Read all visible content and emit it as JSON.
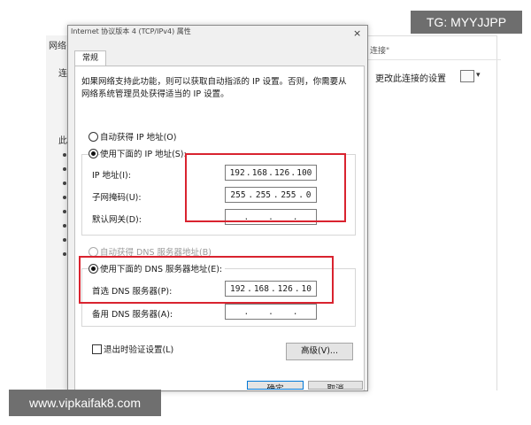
{
  "background_window": {
    "left_title": "网络",
    "left_strip_chars": [
      "连",
      "此"
    ],
    "address_text": "连接\"",
    "change_settings_label": "更改此连接的设置",
    "view_icon": "view-options-icon",
    "view_arrow": "▾"
  },
  "dialog": {
    "title": "Internet 协议版本 4 (TCP/IPv4) 属性",
    "close_glyph": "×",
    "tab_general": "常规",
    "description": "如果网络支持此功能，则可以获取自动指派的 IP 设置。否则，你需要从网络系统管理员处获得适当的 IP 设置。",
    "auto_ip_label": "自动获得 IP 地址(O)",
    "use_ip_label": "使用下面的 IP 地址(S):",
    "ip_address_label": "IP 地址(I):",
    "subnet_label": "子网掩码(U):",
    "gateway_label": "默认网关(D):",
    "ip_address": [
      "192",
      "168",
      "126",
      "100"
    ],
    "subnet_mask": [
      "255",
      "255",
      "255",
      "0"
    ],
    "gateway": [
      "",
      "",
      "",
      ""
    ],
    "auto_dns_label": "自动获得 DNS 服务器地址(B)",
    "use_dns_label": "使用下面的 DNS 服务器地址(E):",
    "preferred_dns_label": "首选 DNS 服务器(P):",
    "alternate_dns_label": "备用 DNS 服务器(A):",
    "preferred_dns": [
      "192",
      "168",
      "126",
      "10"
    ],
    "alternate_dns": [
      "",
      "",
      "",
      ""
    ],
    "validate_label": "退出时验证设置(L)",
    "advanced_button": "高级(V)...",
    "ok_button": "确定",
    "cancel_button": "取消",
    "selected_ip_mode": "manual",
    "selected_dns_mode": "manual",
    "validate_checked": false
  },
  "watermarks": {
    "tg": "TG: MYYJJPP",
    "url": "www.vipkaifak8.com"
  },
  "colors": {
    "highlight_box": "#d9232f",
    "dialog_bg": "#f0f0f0",
    "panel_bg": "#ffffff"
  }
}
